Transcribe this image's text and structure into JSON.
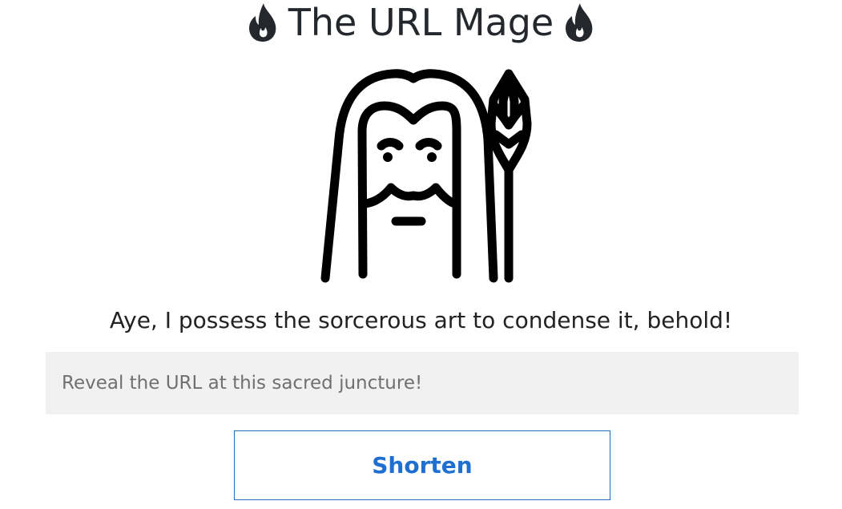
{
  "header": {
    "title": "The URL Mage",
    "left_icon": "flame-icon",
    "right_icon": "flame-icon"
  },
  "hero": {
    "icon": "wizard-icon"
  },
  "tagline": "Aye, I possess the sorcerous art to condense it, behold!",
  "url_form": {
    "input_value": "",
    "input_placeholder": "Reveal the URL at this sacred juncture!",
    "submit_label": "Shorten"
  },
  "colors": {
    "text": "#24272c",
    "input_background": "#f1f1f1",
    "button_border": "#2a6cb8",
    "button_text": "#1f6fd1"
  }
}
